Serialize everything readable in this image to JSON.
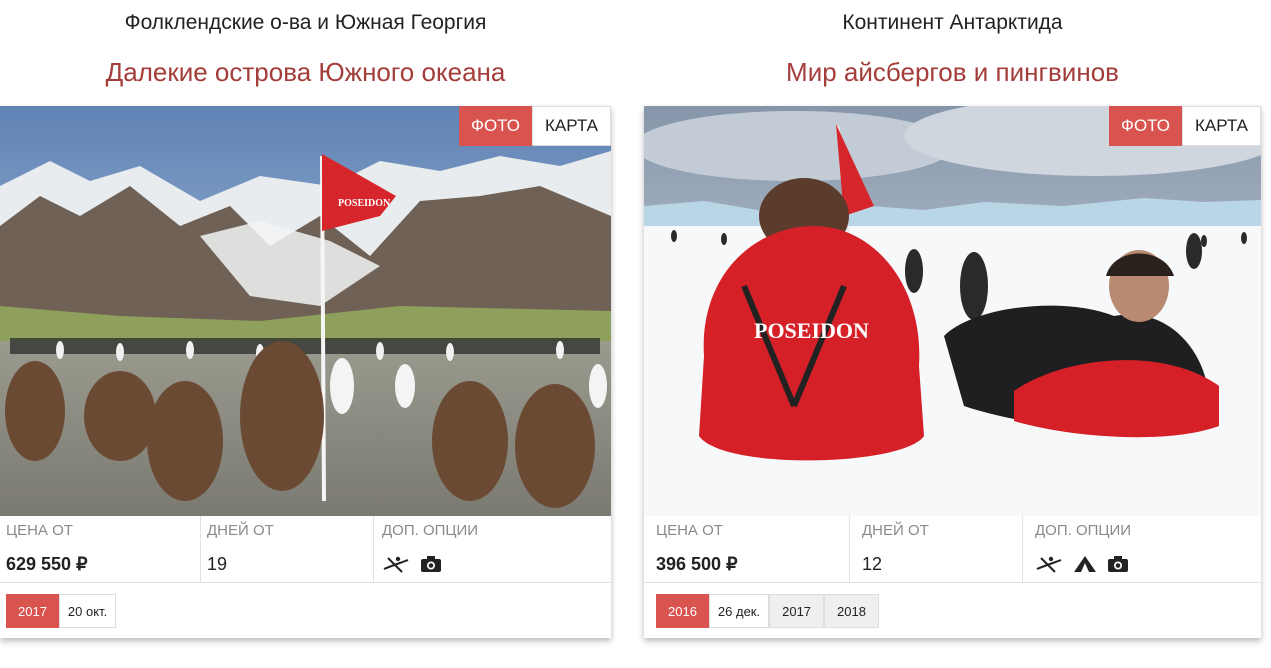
{
  "tours": [
    {
      "region": "Фолклендские о-ва и Южная Георгия",
      "title": "Далекие острова Южного океана",
      "photo_alt": "",
      "toggle": {
        "photo": "ФОТО",
        "map": "КАРТА"
      },
      "price_label": "ЦЕНА ОТ",
      "price": "629 550 ₽",
      "days_label": "ДНЕЙ ОТ",
      "days": "19",
      "options_label": "ДОП. ОПЦИИ",
      "options": [
        "kayak-icon",
        "camera-icon"
      ],
      "dates": {
        "active_year": "2017",
        "day": "20 окт.",
        "years": []
      }
    },
    {
      "region": "Континент Антарктида",
      "title": "Мир айсбергов и пингвинов",
      "photo_alt": "",
      "toggle": {
        "photo": "ФОТО",
        "map": "КАРТА"
      },
      "price_label": "ЦЕНА ОТ",
      "price": "396 500 ₽",
      "days_label": "ДНЕЙ ОТ",
      "days": "12",
      "options_label": "ДОП. ОПЦИИ",
      "options": [
        "kayak-icon",
        "tent-icon",
        "camera-icon"
      ],
      "dates": {
        "active_year": "2016",
        "day": "26 дек.",
        "years": [
          "2017",
          "2018"
        ]
      }
    }
  ],
  "colors": {
    "accent": "#d9534f",
    "title": "#a33d3a",
    "label": "#8a8a8a"
  }
}
